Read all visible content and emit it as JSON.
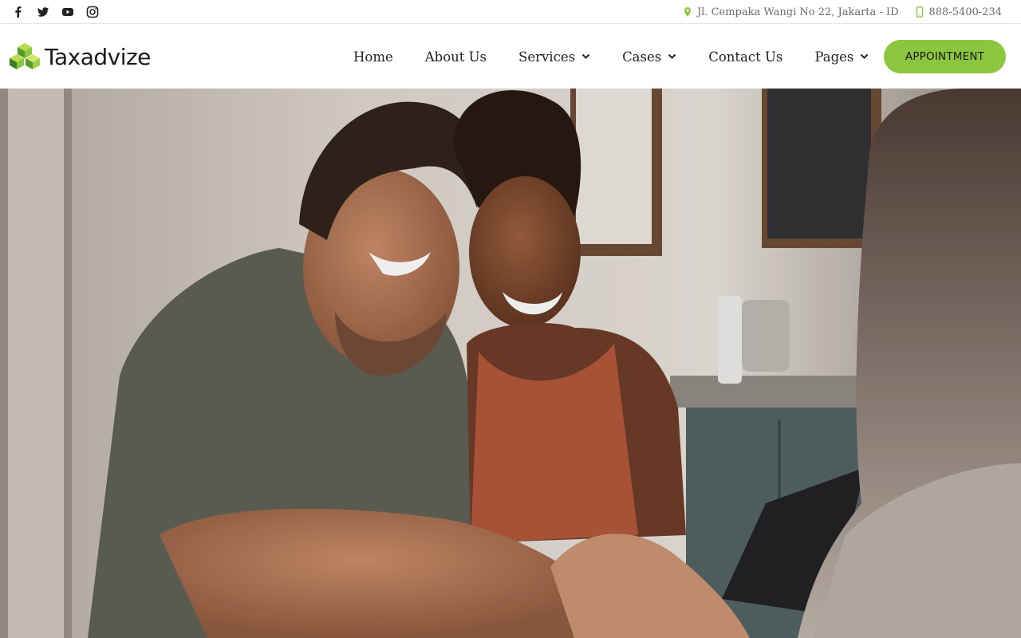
{
  "topbar": {
    "social": [
      {
        "icon": "facebook-icon"
      },
      {
        "icon": "twitter-icon"
      },
      {
        "icon": "youtube-icon"
      },
      {
        "icon": "instagram-icon"
      }
    ],
    "address": "Jl. Cempaka Wangi No 22, Jakarta - ID",
    "phone": "888-5400-234"
  },
  "header": {
    "logo_text": "Taxadvize",
    "nav": [
      {
        "label": "Home",
        "dropdown": false
      },
      {
        "label": "About Us",
        "dropdown": false
      },
      {
        "label": "Services",
        "dropdown": true
      },
      {
        "label": "Cases",
        "dropdown": true
      },
      {
        "label": "Contact Us",
        "dropdown": false
      },
      {
        "label": "Pages",
        "dropdown": true
      }
    ],
    "cta_label": "APPOINTMENT"
  },
  "colors": {
    "accent": "#8cc63f",
    "text": "#1a1a1a",
    "muted": "#6a6a6a"
  }
}
